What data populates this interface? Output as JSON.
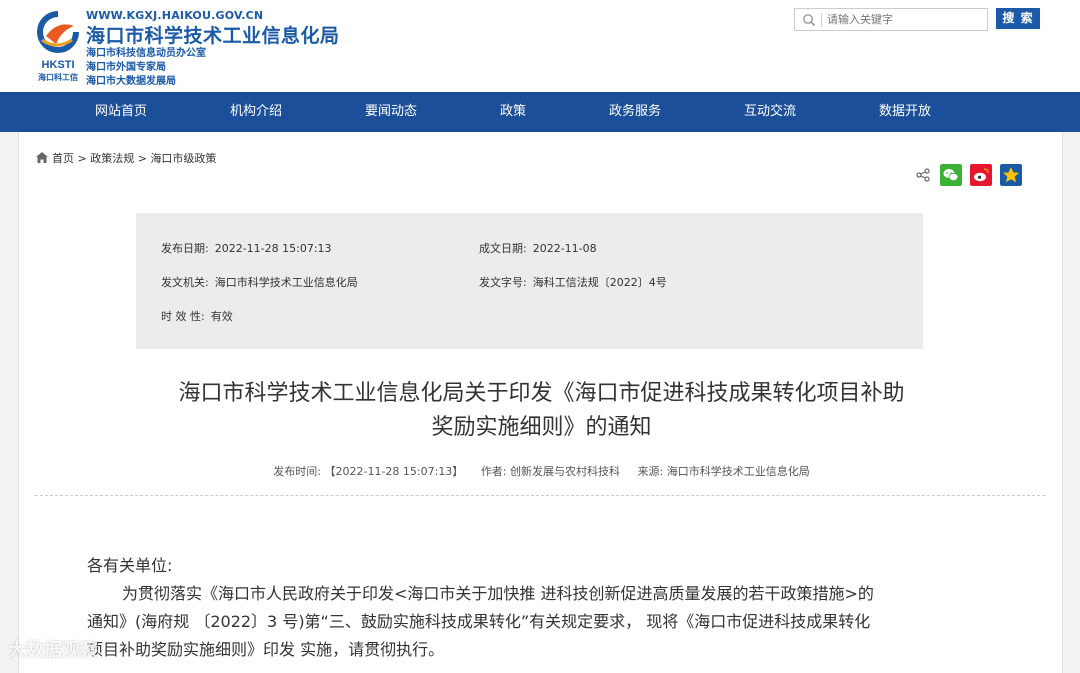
{
  "header": {
    "logo_text": "HKSTI",
    "logo_subtext": "海口科工信",
    "url": "WWW.KGXJ.HAIKOU.GOV.CN",
    "title": "海口市科学技术工业信息化局",
    "sub1": "海口市科技信息动员办公室",
    "sub2": "海口市外国专家局",
    "sub3": "海口市大数据发展局"
  },
  "search": {
    "placeholder": "请输入关键字",
    "button": "搜 索"
  },
  "nav": [
    "网站首页",
    "机构介绍",
    "要闻动态",
    "政策",
    "政务服务",
    "互动交流",
    "数据开放"
  ],
  "breadcrumb": {
    "home": "首页",
    "sep": ">",
    "level2": "政策法规",
    "level3": "海口市级政策"
  },
  "info": {
    "publish_date_label": "发布日期:",
    "publish_date": "2022-11-28 15:07:13",
    "created_date_label": "成文日期:",
    "created_date": "2022-11-08",
    "issuer_label": "发文机关:",
    "issuer": "海口市科学技术工业信息化局",
    "doc_no_label": "发文字号:",
    "doc_no": "海科工信法规〔2022〕4号",
    "validity_label": "时 效 性:",
    "validity": "有效"
  },
  "article": {
    "title_line1": "海口市科学技术工业信息化局关于印发《海口市促进科技成果转化项目补助",
    "title_line2": "奖励实施细则》的通知",
    "meta_time": "发布时间:  【2022-11-28 15:07:13】",
    "meta_author": "作者:  创新发展与农村科技科",
    "meta_source": "来源:  海口市科学技术工业信息化局",
    "salutation": "各有关单位:",
    "para_line1": "为贯彻落实《海口市人民政府关于印发<海口市关于加快推 进科技创新促进高质量发展的若干政策措施>的",
    "para_line2": "通知》(海府规 〔2022〕3 号)第“三、鼓励实施科技成果转化”有关规定要求， 现将《海口市促进科技成果转化",
    "para_line3": "项目补助奖励实施细则》印发 实施，请贯彻执行。"
  },
  "watermark": "大数据观察",
  "colors": {
    "brand_blue": "#1a5aa6",
    "nav_blue": "#1c4f99",
    "wechat_green": "#3cb034",
    "weibo_red": "#e6162d",
    "star_yellow": "#f5c400"
  }
}
